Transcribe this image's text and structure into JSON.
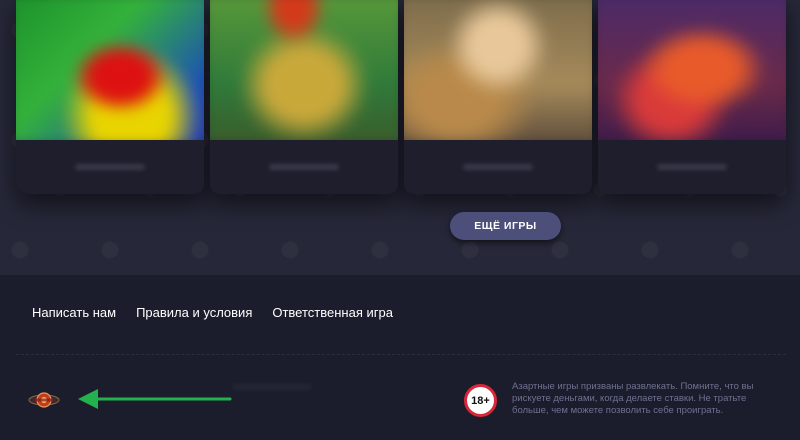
{
  "games": {
    "cards": [
      {
        "id": "game-card-1"
      },
      {
        "id": "game-card-2"
      },
      {
        "id": "game-card-3"
      },
      {
        "id": "game-card-4"
      }
    ],
    "more_button_label": "ЕЩЁ ИГРЫ"
  },
  "footer": {
    "nav": [
      {
        "label": "Написать нам"
      },
      {
        "label": "Правила и условия"
      },
      {
        "label": "Ответственная игра"
      }
    ],
    "age_badge": "18+",
    "disclaimer": "Азартные игры призваны развлекать. Помните, что вы рискуете деньгами, когда делаете ставки. Не тратьте больше, чем можете позволить себе проиграть."
  },
  "colors": {
    "background": "#262738",
    "footer_background": "#1c1d2c",
    "button": "#4b4f7a",
    "arrow": "#22b14c",
    "badge_border": "#d8263a"
  },
  "icons": [
    "casino-logo-icon",
    "green-arrow-icon"
  ]
}
